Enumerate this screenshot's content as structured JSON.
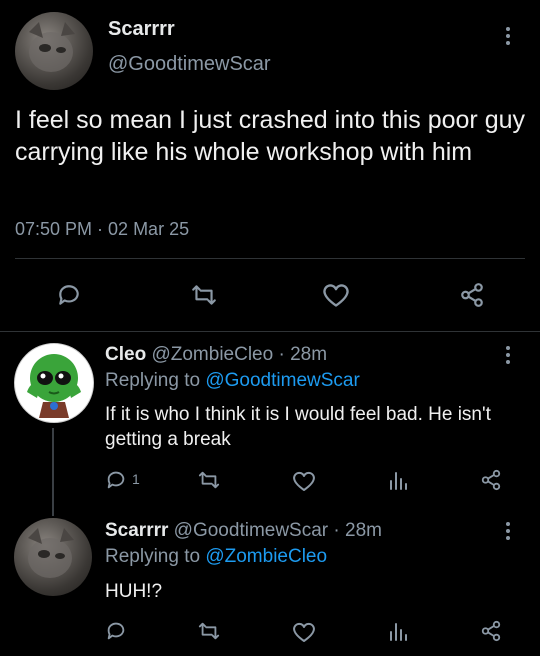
{
  "main_tweet": {
    "display_name": "Scarrrr",
    "handle": "@GoodtimewScar",
    "text": "I feel so mean I just crashed into this poor guy carrying like his whole workshop with him",
    "timestamp": "07:50 PM · 02 Mar 25",
    "actions": [
      "reply-icon",
      "retweet-icon",
      "like-icon",
      "share-icon"
    ]
  },
  "replies": [
    {
      "display_name": "Cleo",
      "handle": "@ZombieCleo",
      "time": "· 28m",
      "replying_label": "Replying to",
      "replying_to": "@GoodtimewScar",
      "text": "If it is who I think it is I would feel bad. He isn't getting a break",
      "reply_count": "1",
      "avatar": "green-character-avatar"
    },
    {
      "display_name": "Scarrrr",
      "handle": "@GoodtimewScar",
      "time": "· 28m",
      "replying_label": "Replying to",
      "replying_to": "@ZombieCleo",
      "text": "HUH!?",
      "reply_count": "",
      "avatar": "cat-photo-avatar"
    }
  ],
  "colors": {
    "background": "#000000",
    "text": "#e7e9ea",
    "muted": "#8b98a5",
    "link": "#1d9bf0",
    "divider": "#2f3336"
  }
}
